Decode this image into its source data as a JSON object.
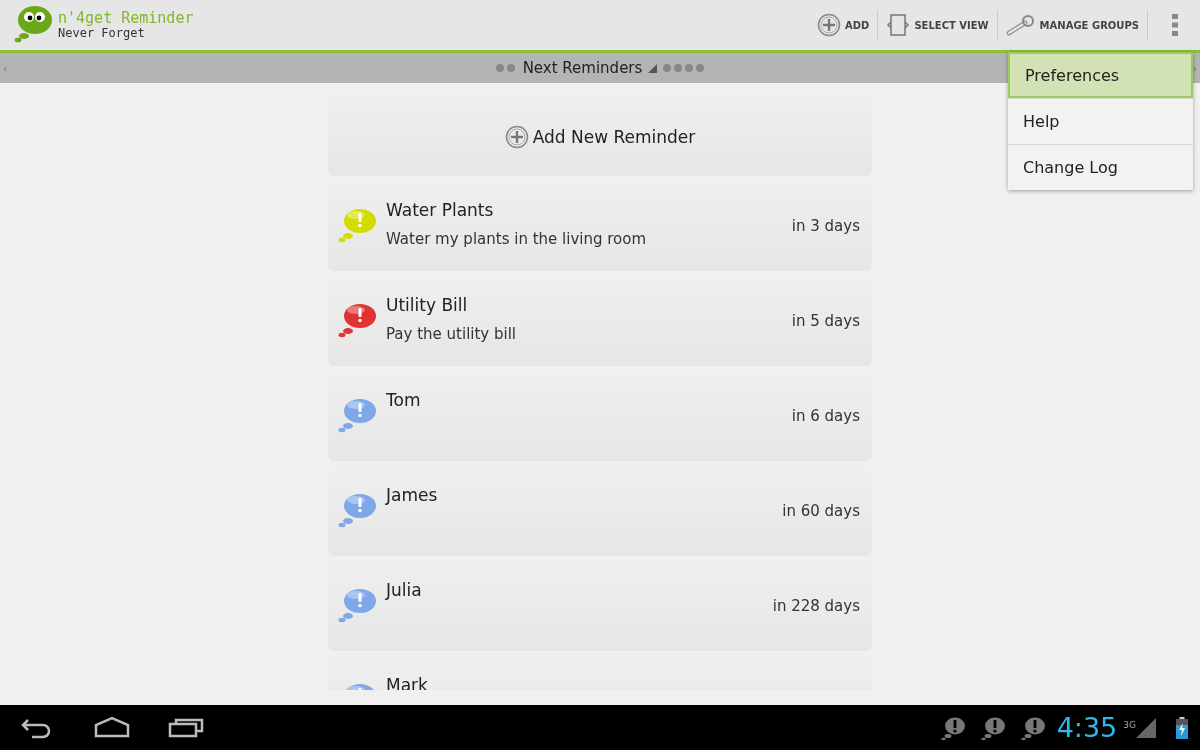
{
  "app": {
    "title": "n'4get Reminder",
    "subtitle": "Never Forget"
  },
  "actions": [
    {
      "kind": "add",
      "label": "ADD"
    },
    {
      "kind": "view",
      "label": "SELECT VIEW"
    },
    {
      "kind": "groups",
      "label": "MANAGE GROUPS"
    }
  ],
  "tab_strip": {
    "left_arrow": "‹",
    "title": "Next Reminders",
    "right_arrow": "›"
  },
  "add_button": {
    "label": "Add New Reminder"
  },
  "reminders": [
    {
      "title": "Water Plants",
      "note": "Water my plants in the living room",
      "due": "in 3 days",
      "color": "#d2dc00"
    },
    {
      "title": "Utility Bill",
      "note": "Pay the utility bill",
      "due": "in 5 days",
      "color": "#e03434"
    },
    {
      "title": "Tom",
      "due": "in 6 days",
      "color": "#7ea8e8"
    },
    {
      "title": "James",
      "due": "in 60 days",
      "color": "#7ea8e8"
    },
    {
      "title": "Julia",
      "due": "in 228 days",
      "color": "#7ea8e8"
    },
    {
      "title": "Mark",
      "color": "#7ea8e8"
    }
  ],
  "menu": [
    {
      "label": "Preferences",
      "selected": true
    },
    {
      "label": "Help",
      "selected": false
    },
    {
      "label": "Change Log",
      "selected": false
    }
  ],
  "status_bar": {
    "notifications": [
      {
        "kind": "reminder"
      },
      {
        "kind": "reminder"
      },
      {
        "kind": "reminder"
      }
    ],
    "time": "4:35",
    "network": "3G"
  }
}
